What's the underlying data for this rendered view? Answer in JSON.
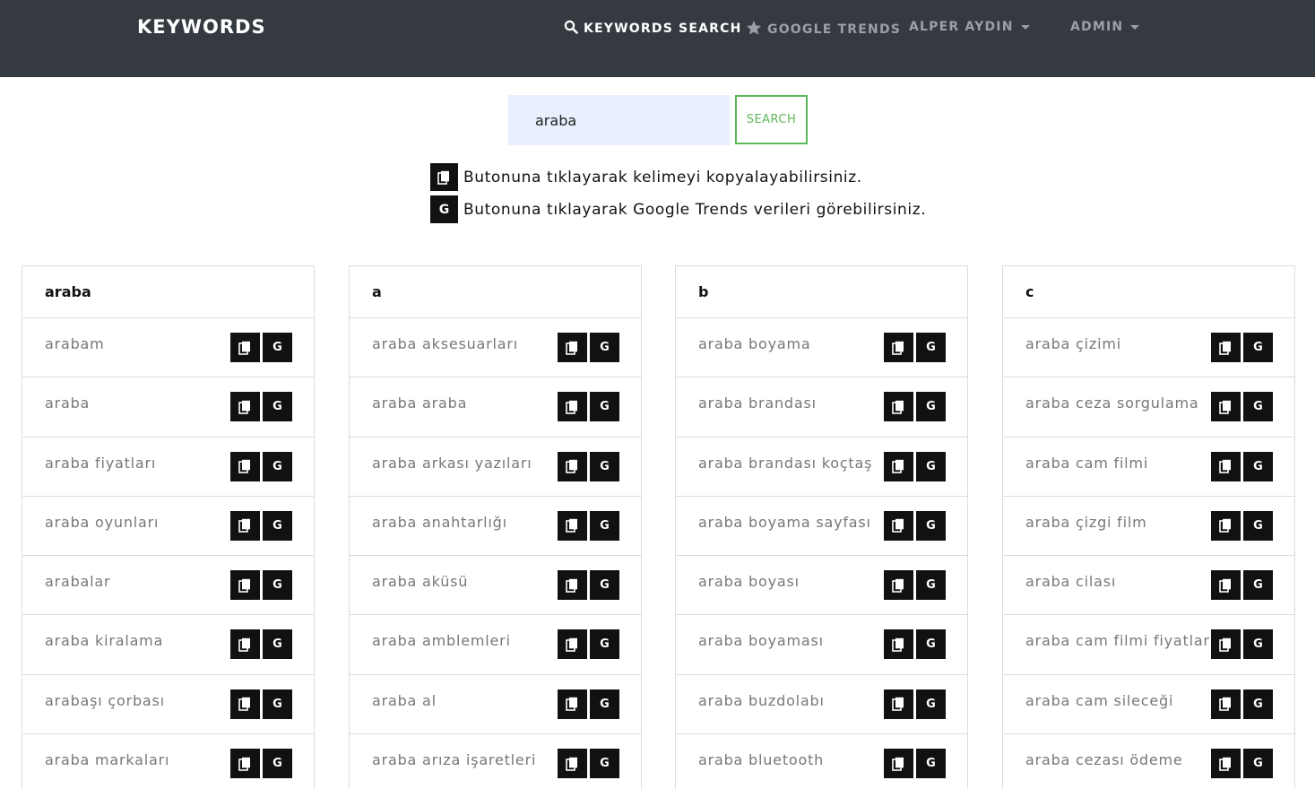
{
  "navbar": {
    "brand": "KEYWORDS",
    "items": [
      {
        "label": "KEYWORDS SEARCH",
        "icon": "search-icon"
      },
      {
        "label": "GOOGLE TRENDS",
        "icon": "star-icon"
      },
      {
        "label": "ALPER AYDIN"
      },
      {
        "label": "ADMIN"
      }
    ]
  },
  "search": {
    "value": "araba",
    "button_label": "SEARCH"
  },
  "info": [
    {
      "icon_label": "",
      "text": "Butonuna tıklayarak kelimeyi kopyalayabilirsiniz."
    },
    {
      "icon_label": "G",
      "text": "Butonuna tıklayarak Google Trends verileri görebilirsiniz."
    }
  ],
  "g_label": "G",
  "columns": [
    {
      "title": "araba",
      "items": [
        "arabam",
        "araba",
        "araba fiyatları",
        "araba oyunları",
        "arabalar",
        "araba kiralama",
        "arabaşı çorbası",
        "araba markaları"
      ]
    },
    {
      "title": "a",
      "items": [
        "araba aksesuarları",
        "araba araba",
        "araba arkası yazıları",
        "araba anahtarlığı",
        "araba aküsü",
        "araba amblemleri",
        "araba al",
        "araba arıza işaretleri"
      ]
    },
    {
      "title": "b",
      "items": [
        "araba boyama",
        "araba brandası",
        "araba brandası koçtaş",
        "araba boyama sayfası",
        "araba boyası",
        "araba boyaması",
        "araba buzdolabı",
        "araba bluetooth"
      ]
    },
    {
      "title": "c",
      "items": [
        "araba çizimi",
        "araba ceza sorgulama",
        "araba cam filmi",
        "araba çizgi film",
        "araba cilası",
        "araba cam filmi fiyatları",
        "araba cam sileceği",
        "araba cezası ödeme"
      ]
    }
  ]
}
